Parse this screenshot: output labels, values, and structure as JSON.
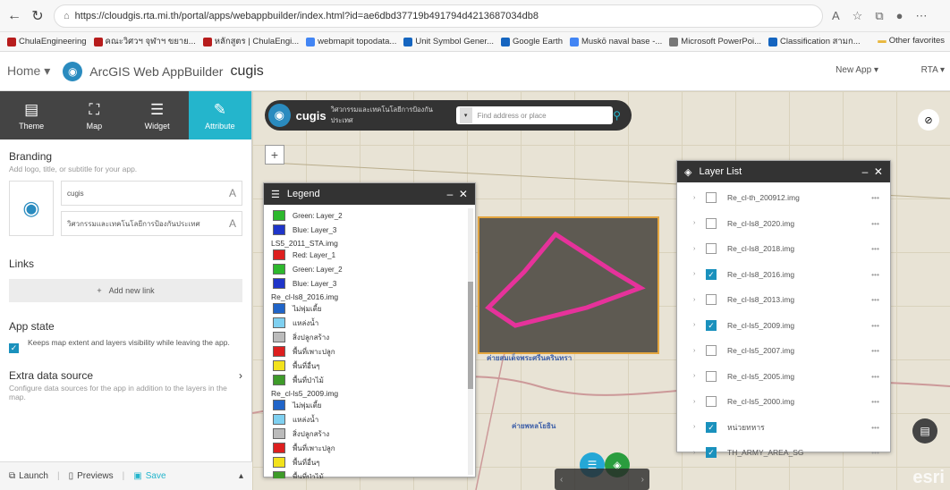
{
  "browser": {
    "url": "https://cloudgis.rta.mi.th/portal/apps/webappbuilder/index.html?id=ae6dbd37719b491794d4213687034db8",
    "bookmarks": [
      {
        "label": "ChulaEngineering",
        "color": "#b71c1c"
      },
      {
        "label": "คณะวิศวฯ จุฬาฯ ขยาย...",
        "color": "#b71c1c"
      },
      {
        "label": "หลักสูตร | ChulaEngi...",
        "color": "#b71c1c"
      },
      {
        "label": "webmapit topodata...",
        "color": "#4285f4"
      },
      {
        "label": "Unit Symbol Gener...",
        "color": "#1565c0"
      },
      {
        "label": "Google Earth",
        "color": "#1565c0"
      },
      {
        "label": "Muskō naval base -...",
        "color": "#4285f4"
      },
      {
        "label": "Microsoft PowerPoi...",
        "color": "#777777"
      },
      {
        "label": "Classification สามก...",
        "color": "#1565c0"
      }
    ],
    "other_favorites": "Other favorites"
  },
  "header": {
    "home": "Home",
    "app_builder": "ArcGIS Web AppBuilder",
    "app_name": "cugis",
    "new_app": "New App",
    "user": "RTA"
  },
  "sidebar": {
    "tabs": [
      {
        "label": "Theme",
        "icon": "▤"
      },
      {
        "label": "Map",
        "icon": "⛶"
      },
      {
        "label": "Widget",
        "icon": "☰"
      },
      {
        "label": "Attribute",
        "icon": "✎"
      }
    ],
    "branding": {
      "title": "Branding",
      "desc": "Add logo, title, or subtitle for your app.",
      "title_value": "cugis",
      "subtitle_value": "วิศวกรรมและเทคโนโลยีการป้องกันประเทศ"
    },
    "links": {
      "title": "Links",
      "add_label": "Add new link"
    },
    "app_state": {
      "title": "App state",
      "desc": "Keeps map extent and layers visibility while leaving the app.",
      "checked": true
    },
    "extra_data": {
      "title": "Extra data source",
      "desc": "Configure data sources for the app in addition to the layers in the map."
    },
    "footer": {
      "launch": "Launch",
      "previews": "Previews",
      "save": "Save"
    }
  },
  "search": {
    "title": "cugis",
    "subtitle": "วิศวกรรมและเทคโนโลยีการป้องกันประเทศ",
    "placeholder": "Find address or place"
  },
  "legend": {
    "title": "Legend",
    "groups": [
      {
        "name": "",
        "items": [
          {
            "label": "Green: Layer_2",
            "color": "#2db82d"
          },
          {
            "label": "Blue: Layer_3",
            "color": "#1f35c9"
          }
        ]
      },
      {
        "name": "LS5_2011_STA.img",
        "items": [
          {
            "label": "Red: Layer_1",
            "color": "#dd1f1f"
          },
          {
            "label": "Green: Layer_2",
            "color": "#2db82d"
          },
          {
            "label": "Blue: Layer_3",
            "color": "#1f35c9"
          }
        ]
      },
      {
        "name": "Re_cl-ls8_2016.img",
        "items": [
          {
            "label": "ไม่พุ่มเตี้ย",
            "color": "#2064c8"
          },
          {
            "label": "แหล่งน้ำ",
            "color": "#7fd0f0"
          },
          {
            "label": "สิ่งปลูกสร้าง",
            "color": "#bbbbbb"
          },
          {
            "label": "พื้นที่เพาะปลูก",
            "color": "#dd1f1f"
          },
          {
            "label": "พื้นที่อื่นๆ",
            "color": "#f2e21c"
          },
          {
            "label": "พื้นที่ป่าไม้",
            "color": "#3e9b2a"
          }
        ]
      },
      {
        "name": "Re_cl-ls5_2009.img",
        "items": [
          {
            "label": "ไม่พุ่มเตี้ย",
            "color": "#2064c8"
          },
          {
            "label": "แหล่งน้ำ",
            "color": "#7fd0f0"
          },
          {
            "label": "สิ่งปลูกสร้าง",
            "color": "#bbbbbb"
          },
          {
            "label": "พื้นที่เพาะปลูก",
            "color": "#dd1f1f"
          },
          {
            "label": "พื้นที่อื่นๆ",
            "color": "#f2e21c"
          },
          {
            "label": "พื้นที่ป่าไม้",
            "color": "#3e9b2a"
          }
        ]
      }
    ]
  },
  "layer_list": {
    "title": "Layer List",
    "layers": [
      {
        "name": "Re_cl-th_200912.img",
        "checked": false
      },
      {
        "name": "Re_cl-ls8_2020.img",
        "checked": false
      },
      {
        "name": "Re_cl-ls8_2018.img",
        "checked": false
      },
      {
        "name": "Re_cl-ls8_2016.img",
        "checked": true
      },
      {
        "name": "Re_cl-ls8_2013.img",
        "checked": false
      },
      {
        "name": "Re_cl-ls5_2009.img",
        "checked": true
      },
      {
        "name": "Re_cl-ls5_2007.img",
        "checked": false
      },
      {
        "name": "Re_cl-ls5_2005.img",
        "checked": false
      },
      {
        "name": "Re_cl-ls5_2000.img",
        "checked": false
      },
      {
        "name": "หน่วยทหาร",
        "checked": true
      },
      {
        "name": "TH_ARMY_AREA_SG",
        "checked": true
      }
    ]
  },
  "map_labels": [
    "ค่ายสมเด็จพระศรีนครินทรา",
    "ค่ายพหลโยธิน"
  ],
  "esri": "esri",
  "colors": {
    "accent": "#24b5cc",
    "polygon": "#e6329b",
    "imagery_border": "#e4a640"
  }
}
